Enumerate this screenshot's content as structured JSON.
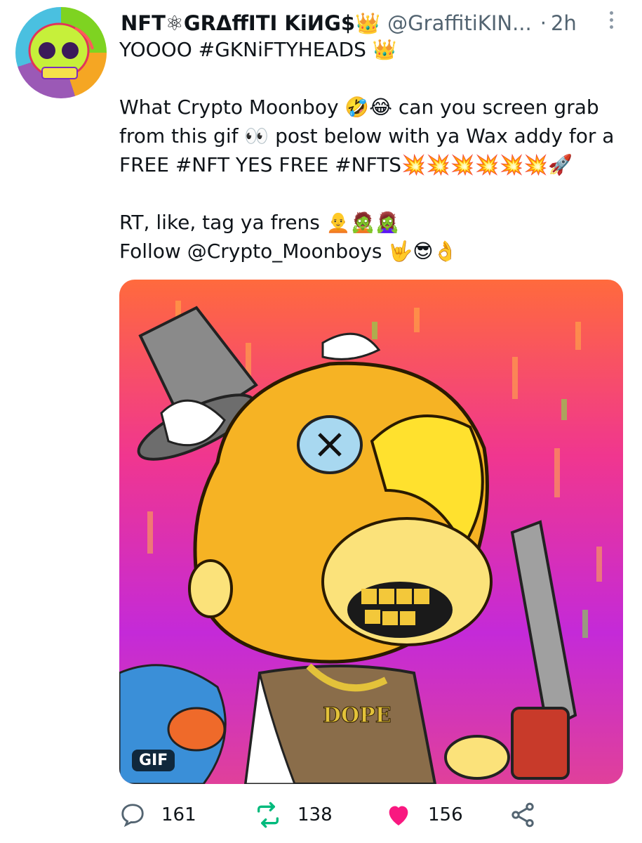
{
  "tweet": {
    "display_name": "NFT⚛GRΔffITI KiИG$👑",
    "handle": "@GraffitiKIN...",
    "separator": "·",
    "time": "2h",
    "text": "YOOOO #GKNiFTYHEADS 👑\n\nWhat Crypto Moonboy 🤣😂 can you screen grab from this gif 👀 post below with ya Wax addy for a FREE #NFT YES FREE #NFTS💥💥💥💥💥💥🚀\n\nRT, like, tag ya frens 🧑‍🦲🧟🧟‍♀️\nFollow @Crypto_Moonboys 🤟😎👌"
  },
  "media": {
    "badge": "GIF",
    "chain_tag": "DOPE"
  },
  "actions": {
    "reply_count": "161",
    "retweet_count": "138",
    "like_count": "156"
  },
  "colors": {
    "secondary_text": "#536471",
    "retweet_green": "#00ba7c",
    "like_red": "#f91880"
  },
  "icons": [
    "avatar-skull",
    "more-icon",
    "reply-icon",
    "retweet-icon",
    "heart-icon",
    "share-icon"
  ]
}
